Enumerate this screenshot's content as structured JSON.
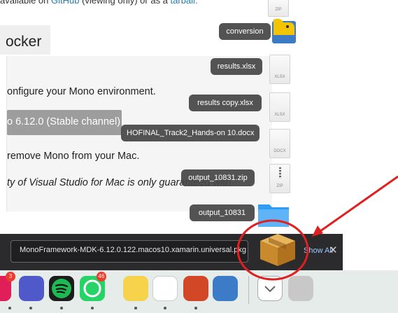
{
  "page": {
    "top_line_prefix": "available on ",
    "top_link_1": "GitHub",
    "top_line_middle": " (viewing only) or as a ",
    "top_link_2": "tarball.",
    "tab_title": "ocker",
    "line_1": "onfigure your Mono environment.",
    "button_label": "o 6.12.0 (Stable channel)",
    "line_2": "remove Mono from your Mac.",
    "line_3": "ty of Visual Studio for Mac is only guaranteed with"
  },
  "stack": {
    "items": [
      {
        "label": "conversion",
        "icon": "python-folder-icon"
      },
      {
        "label": "results.xlsx",
        "icon": "xlsx-file-icon",
        "tag": "XLSX"
      },
      {
        "label": "results copy.xlsx",
        "icon": "xlsx-file-icon",
        "tag": "XLSX"
      },
      {
        "label": "HOFINAL_Track2_Hands-on 10.docx",
        "icon": "docx-file-icon",
        "tag": "DOCX"
      },
      {
        "label": "output_10831.zip",
        "icon": "zip-file-icon",
        "tag": "ZIP"
      },
      {
        "label": "output_10831",
        "icon": "blue-folder-icon"
      }
    ],
    "top_zip_tag": "ZIP"
  },
  "download_bar": {
    "filename": "MonoFramework-MDK-6.12.0.122.macos10.xamarin.universal.pkg",
    "show_all": "Show All",
    "close": "✕"
  },
  "dock": {
    "apps": [
      {
        "name": "slack-icon",
        "badge": "3",
        "color": "#e01e5a"
      },
      {
        "name": "teams-icon",
        "badge": "",
        "color": "#5059c9"
      },
      {
        "name": "spotify-icon",
        "badge": "",
        "color": "#1db954"
      },
      {
        "name": "whatsapp-icon",
        "badge": "46",
        "color": "#25d366"
      },
      {
        "name": "notes-icon",
        "badge": "",
        "color": "#f7d24b"
      },
      {
        "name": "textedit-icon",
        "badge": "",
        "color": "#ffffff"
      },
      {
        "name": "powerpoint-icon",
        "badge": "",
        "color": "#d24726"
      },
      {
        "name": "python-launcher-icon",
        "badge": "",
        "color": "#3b7bc7"
      },
      {
        "name": "downloads-stack-icon",
        "badge": "",
        "color": "#ffffff"
      },
      {
        "name": "trash-icon",
        "badge": "",
        "color": "#c8c8c8"
      }
    ]
  },
  "colors": {
    "annotation_red": "#e02020",
    "link_blue": "#1f7ab8"
  }
}
